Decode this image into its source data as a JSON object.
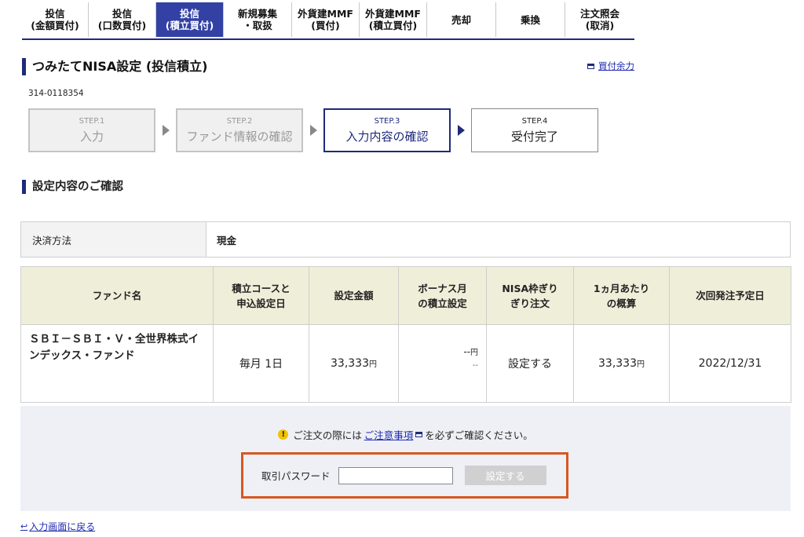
{
  "tabs": [
    {
      "line1": "投信",
      "line2": "(金額買付)"
    },
    {
      "line1": "投信",
      "line2": "(口数買付)"
    },
    {
      "line1": "投信",
      "line2": "(積立買付)"
    },
    {
      "line1": "新規募集",
      "line2": "・取扱"
    },
    {
      "line1": "外貨建MMF",
      "line2": "(買付)"
    },
    {
      "line1": "外貨建MMF",
      "line2": "(積立買付)"
    },
    {
      "line1": "売却",
      "line2": ""
    },
    {
      "line1": "乗換",
      "line2": ""
    },
    {
      "line1": "注文照会",
      "line2": "(取消)"
    }
  ],
  "active_tab": 2,
  "page": {
    "title": "つみたてNISA設定 (投信積立)",
    "buy_power_link": "買付余力",
    "account_number": "314-0118354"
  },
  "steps": [
    {
      "num": "STEP.1",
      "label": "入力"
    },
    {
      "num": "STEP.2",
      "label": "ファンド情報の確認"
    },
    {
      "num": "STEP.3",
      "label": "入力内容の確認"
    },
    {
      "num": "STEP.4",
      "label": "受付完了"
    }
  ],
  "section_title": "設定内容のご確認",
  "payment": {
    "label": "決済方法",
    "value": "現金"
  },
  "fund_table": {
    "headers": {
      "fund_name": "ファンド名",
      "course_line1": "積立コースと",
      "course_line2": "申込設定日",
      "amount": "設定金額",
      "bonus_line1": "ボーナス月",
      "bonus_line2": "の積立設定",
      "nisa_line1": "NISA枠ぎり",
      "nisa_line2": "ぎり注文",
      "monthly_line1": "1ヵ月あたり",
      "monthly_line2": "の概算",
      "next_date": "次回発注予定日"
    },
    "row": {
      "fund_name": "ＳＢＩ－ＳＢＩ・Ｖ・全世界株式インデックス・ファンド",
      "course": "毎月 1日",
      "amount": "33,333",
      "yen": "円",
      "bonus_amount": "--",
      "bonus_yen": "円",
      "bonus_sub": "--",
      "nisa": "設定する",
      "monthly": "33,333",
      "next_date": "2022/12/31"
    }
  },
  "confirm": {
    "notice_before": "ご注文の際には",
    "notice_link": "ご注意事項",
    "notice_after": "を必ずご確認ください。",
    "password_label": "取引パスワード",
    "password_value": "",
    "submit_label": "設定する"
  },
  "back_link": "入力画面に戻る",
  "colors": {
    "primary": "#1f2a7a",
    "active_tab": "#3341a4",
    "highlight": "#d8571f",
    "table_header": "#efeed9",
    "confirm_bg": "#eef0f5"
  }
}
